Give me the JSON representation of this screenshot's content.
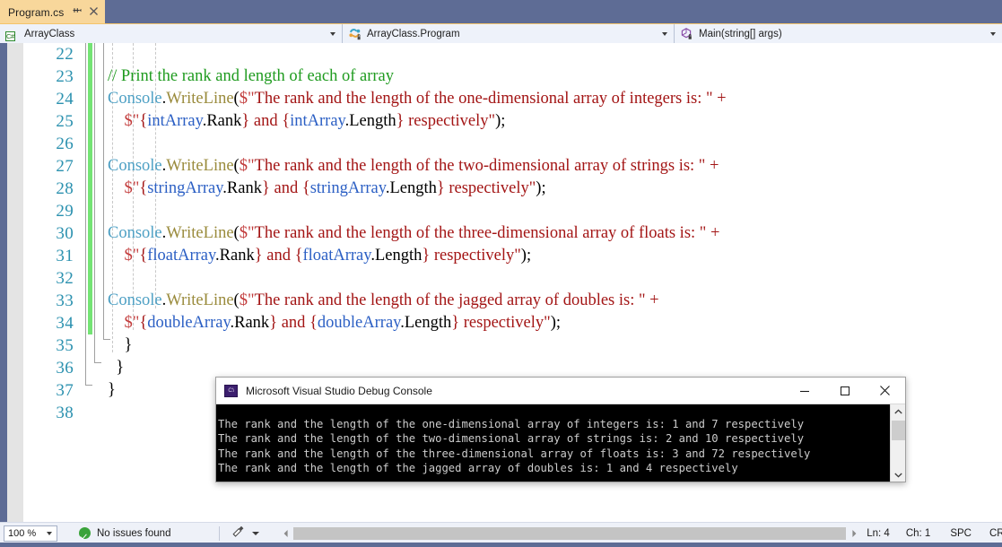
{
  "tab": {
    "title": "Program.cs",
    "pin_icon": "pin-icon",
    "close_icon": "close-icon"
  },
  "navbar": {
    "project_selector": {
      "icon": "csharp-file-icon",
      "icon_label": "C#",
      "value": "ArrayClass"
    },
    "type_selector": {
      "icon": "class-icon",
      "value": "ArrayClass.Program"
    },
    "member_selector": {
      "icon": "method-private-icon",
      "value": "Main(string[] args)"
    }
  },
  "editor": {
    "lines": [
      {
        "n": "22",
        "changed": true,
        "tokens": []
      },
      {
        "n": "23",
        "changed": true,
        "tokens": [
          {
            "c": "t-comment",
            "t": "// Print the rank and length of each of array"
          }
        ],
        "indent": 2
      },
      {
        "n": "24",
        "changed": true,
        "tokens": [
          {
            "c": "t-type",
            "t": "Console"
          },
          {
            "c": "t-punct",
            "t": "."
          },
          {
            "c": "t-method",
            "t": "WriteLine"
          },
          {
            "c": "t-punct",
            "t": "("
          },
          {
            "c": "t-strpunc",
            "t": "$\""
          },
          {
            "c": "t-string",
            "t": "The rank and the length of the one-dimensional array of integers is: \" + "
          }
        ],
        "indent": 2
      },
      {
        "n": "25",
        "changed": true,
        "tokens": [
          {
            "c": "t-strpunc",
            "t": "    $\""
          },
          {
            "c": "t-string",
            "t": "{"
          },
          {
            "c": "t-var",
            "t": "intArray"
          },
          {
            "c": "t-plain",
            "t": ".Rank"
          },
          {
            "c": "t-string",
            "t": "} and {"
          },
          {
            "c": "t-var",
            "t": "intArray"
          },
          {
            "c": "t-plain",
            "t": ".Length"
          },
          {
            "c": "t-string",
            "t": "} respectively\""
          },
          {
            "c": "t-punct",
            "t": ");"
          }
        ],
        "indent": 2
      },
      {
        "n": "26",
        "changed": true,
        "tokens": [],
        "indent": 2
      },
      {
        "n": "27",
        "changed": true,
        "tokens": [
          {
            "c": "t-type",
            "t": "Console"
          },
          {
            "c": "t-punct",
            "t": "."
          },
          {
            "c": "t-method",
            "t": "WriteLine"
          },
          {
            "c": "t-punct",
            "t": "("
          },
          {
            "c": "t-strpunc",
            "t": "$\""
          },
          {
            "c": "t-string",
            "t": "The rank and the length of the two-dimensional array of strings is: \" + "
          }
        ],
        "indent": 2
      },
      {
        "n": "28",
        "changed": true,
        "tokens": [
          {
            "c": "t-strpunc",
            "t": "    $\""
          },
          {
            "c": "t-string",
            "t": "{"
          },
          {
            "c": "t-var",
            "t": "stringArray"
          },
          {
            "c": "t-plain",
            "t": ".Rank"
          },
          {
            "c": "t-string",
            "t": "} and {"
          },
          {
            "c": "t-var",
            "t": "stringArray"
          },
          {
            "c": "t-plain",
            "t": ".Length"
          },
          {
            "c": "t-string",
            "t": "} respectively\""
          },
          {
            "c": "t-punct",
            "t": ");"
          }
        ],
        "indent": 2
      },
      {
        "n": "29",
        "changed": true,
        "tokens": [],
        "indent": 2
      },
      {
        "n": "30",
        "changed": true,
        "tokens": [
          {
            "c": "t-type",
            "t": "Console"
          },
          {
            "c": "t-punct",
            "t": "."
          },
          {
            "c": "t-method",
            "t": "WriteLine"
          },
          {
            "c": "t-punct",
            "t": "("
          },
          {
            "c": "t-strpunc",
            "t": "$\""
          },
          {
            "c": "t-string",
            "t": "The rank and the length of the three-dimensional array of floats is: \" + "
          }
        ],
        "indent": 2
      },
      {
        "n": "31",
        "changed": true,
        "tokens": [
          {
            "c": "t-strpunc",
            "t": "    $\""
          },
          {
            "c": "t-string",
            "t": "{"
          },
          {
            "c": "t-var",
            "t": "floatArray"
          },
          {
            "c": "t-plain",
            "t": ".Rank"
          },
          {
            "c": "t-string",
            "t": "} and {"
          },
          {
            "c": "t-var",
            "t": "floatArray"
          },
          {
            "c": "t-plain",
            "t": ".Length"
          },
          {
            "c": "t-string",
            "t": "} respectively\""
          },
          {
            "c": "t-punct",
            "t": ");"
          }
        ],
        "indent": 2
      },
      {
        "n": "32",
        "changed": true,
        "tokens": [],
        "indent": 2
      },
      {
        "n": "33",
        "changed": true,
        "tokens": [
          {
            "c": "t-type",
            "t": "Console"
          },
          {
            "c": "t-punct",
            "t": "."
          },
          {
            "c": "t-method",
            "t": "WriteLine"
          },
          {
            "c": "t-punct",
            "t": "("
          },
          {
            "c": "t-strpunc",
            "t": "$\""
          },
          {
            "c": "t-string",
            "t": "The rank and the length of the jagged array of doubles is: \" + "
          }
        ],
        "indent": 2
      },
      {
        "n": "34",
        "changed": true,
        "tokens": [
          {
            "c": "t-strpunc",
            "t": "    $\""
          },
          {
            "c": "t-string",
            "t": "{"
          },
          {
            "c": "t-var",
            "t": "doubleArray"
          },
          {
            "c": "t-plain",
            "t": ".Rank"
          },
          {
            "c": "t-string",
            "t": "} and {"
          },
          {
            "c": "t-var",
            "t": "doubleArray"
          },
          {
            "c": "t-plain",
            "t": ".Length"
          },
          {
            "c": "t-string",
            "t": "} respectively\""
          },
          {
            "c": "t-punct",
            "t": ");"
          }
        ],
        "indent": 2
      },
      {
        "n": "35",
        "changed": false,
        "tokens": [
          {
            "c": "t-punct",
            "t": "    }"
          }
        ],
        "indent": 1
      },
      {
        "n": "36",
        "changed": false,
        "tokens": [
          {
            "c": "t-punct",
            "t": "  }"
          }
        ],
        "indent": 0
      },
      {
        "n": "37",
        "changed": false,
        "tokens": [
          {
            "c": "t-punct",
            "t": "}"
          }
        ],
        "indent": 0
      },
      {
        "n": "38",
        "changed": false,
        "tokens": []
      }
    ]
  },
  "console_window": {
    "icon": "console-app-icon",
    "icon_label": "C:\\",
    "title": "Microsoft Visual Studio Debug Console",
    "minimize_label": "–",
    "maximize_label": "",
    "close_label": "✕",
    "scroll_up": "⌃",
    "scroll_down": "⌄",
    "output": "The rank and the length of the one-dimensional array of integers is: 1 and 7 respectively\nThe rank and the length of the two-dimensional array of strings is: 2 and 10 respectively\nThe rank and the length of the three-dimensional array of floats is: 3 and 72 respectively\nThe rank and the length of the jagged array of doubles is: 1 and 4 respectively"
  },
  "statusbar": {
    "zoom": "100 %",
    "issues": "No issues found",
    "brush_icon": "brush-icon",
    "scroll_left": "◀",
    "scroll_right": "▶",
    "line": "Ln: 4",
    "column": "Ch: 1",
    "spaces": "SPC",
    "eol": "CRLF"
  },
  "colors": {
    "chrome": "#5e6c95",
    "tab_active": "#f8d79b",
    "navbar": "#eef2fa",
    "change_bar": "#74e374",
    "comment": "#1f9b1f",
    "type": "#4ea0c4",
    "method": "#9a8b3c",
    "string": "#a31515",
    "variable": "#2b5fc4",
    "linenumber": "#2b91af",
    "console_bg": "#000000",
    "console_fg": "#cccccc",
    "status_ok": "#3aa33a"
  }
}
